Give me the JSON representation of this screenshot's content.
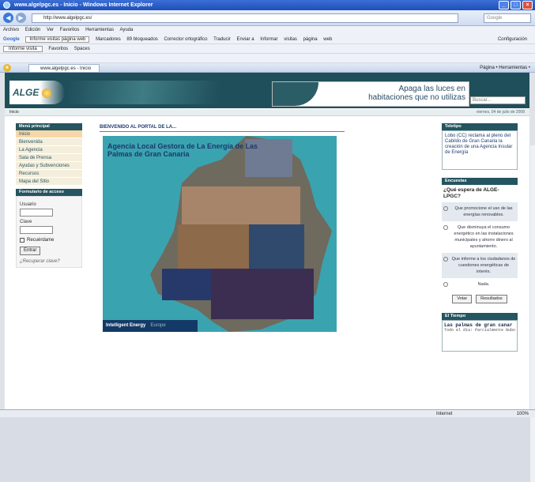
{
  "window": {
    "title": "www.algelpgc.es - Inicio - Windows Internet Explorer"
  },
  "address": {
    "url": "http://www.algelpgc.es/",
    "search_placeholder": "Google"
  },
  "menubar": [
    "Archivo",
    "Edición",
    "Ver",
    "Favoritos",
    "Herramientas",
    "Ayuda"
  ],
  "toolbar1": [
    "Google",
    "Informe visitas página web",
    "Marcadores",
    "89 bloqueados",
    "Corrector ortográfico",
    "Traducir",
    "Enviar a",
    "Informar",
    "visitas",
    "página",
    "web",
    "Configuración"
  ],
  "toolbar2": [
    "Informe visita",
    "Favoritos",
    "Spaces",
    "Página",
    "Herramientas"
  ],
  "tab": {
    "label": "www.algelpgc.es - Inicio",
    "tools": "Página • Herramientas •"
  },
  "banner": {
    "logo": "ALGE",
    "ad_line1": "Apaga las luces en",
    "ad_line2": "habitaciones que no utilizas",
    "search_value": "Buscar..."
  },
  "crumb": {
    "left": "Inicio",
    "date": "viernes, 04 de julio de 2008"
  },
  "menu": {
    "title": "Menú principal",
    "items": [
      "Inicio",
      "Bienvenida",
      "La Agencia",
      "Sala de Prensa",
      "Ayudas y Subvenciones",
      "Recursos",
      "Mapa del Sitio"
    ]
  },
  "login": {
    "title": "Formulario de acceso",
    "user_label": "Usuario",
    "pass_label": "Clave",
    "remember_label": "Recuérdame",
    "submit_label": "Entrar",
    "forgot_label": "¿Recuperar clave?"
  },
  "main": {
    "title": "BIENVENIDO AL PORTAL DE LA...",
    "map_caption": "Agencia Local Gestora de La Energía de Las Palmas de Gran Canaria",
    "footer_left": "Intelligent Energy",
    "footer_right": "Europe"
  },
  "news": {
    "title": "Teletipo",
    "text": "Lobo (CC) reclama al pleno del Cabildo de Gran Canaria la creación de una Agencia Insular de Energía"
  },
  "poll": {
    "title": "Encuestas",
    "question": "¿Qué espera de ALGE-LPGC?",
    "options": [
      "Que promocione el uso de las energías renovables.",
      "Que disminuya el consumo energético en las instalaciones municipales y ahorre dinero al ayuntamiento.",
      "Que informe a los ciudadanos de cuestiones energéticas de interés.",
      "Nada."
    ],
    "vote_label": "Votar",
    "results_label": "Resultados"
  },
  "weather": {
    "title": "El Tiempo",
    "city": "Las palmas de gran canar",
    "sub": "Todo el día: Parcialmente Nubo"
  },
  "status": {
    "zone": "Internet",
    "zoom": "100%"
  }
}
